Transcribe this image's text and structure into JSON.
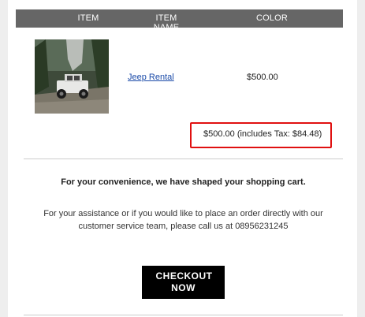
{
  "table": {
    "headers": {
      "item": "ITEM",
      "item_name": "ITEM NAME",
      "color": "COLOR"
    },
    "rows": [
      {
        "image": "jeep-photo",
        "name": "Jeep Rental",
        "price": "$500.00"
      }
    ],
    "total": "$500.00 (includes Tax: $84.48)"
  },
  "message": {
    "headline": "For your convenience, we have shaped your shopping cart.",
    "assist": "For your assistance or if you would like to place an order directly with our customer service team, please call us at 08956231245"
  },
  "checkout_label": "CHECKOUT NOW",
  "colors": {
    "header_bg": "#666666",
    "highlight": "#e01010",
    "button_bg": "#000000",
    "link": "#1a4aa8"
  }
}
